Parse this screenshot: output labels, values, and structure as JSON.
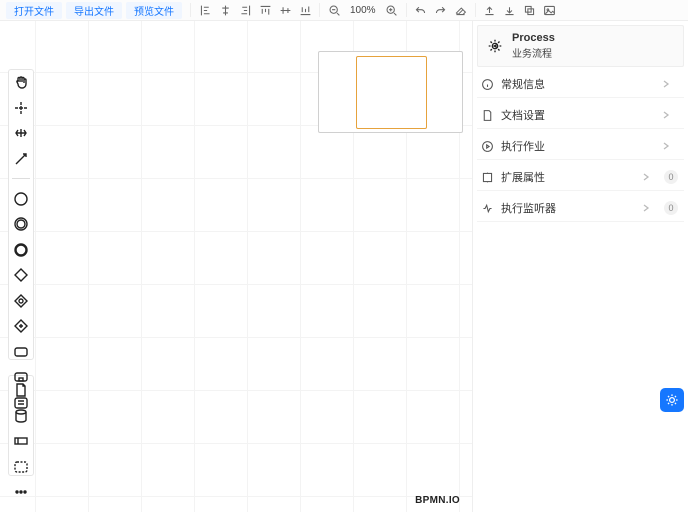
{
  "toolbar": {
    "file_buttons": [
      "打开文件",
      "导出文件",
      "预览文件"
    ],
    "zoom_pct": "100%"
  },
  "minimap": {},
  "brand": "BPMN.IO",
  "props": {
    "header": {
      "title": "Process",
      "subtitle": "业务流程"
    },
    "rows": [
      {
        "label": "常规信息"
      },
      {
        "label": "文档设置"
      },
      {
        "label": "执行作业"
      },
      {
        "label": "扩展属性",
        "count": 0
      },
      {
        "label": "执行监听器",
        "count": 0
      }
    ]
  }
}
